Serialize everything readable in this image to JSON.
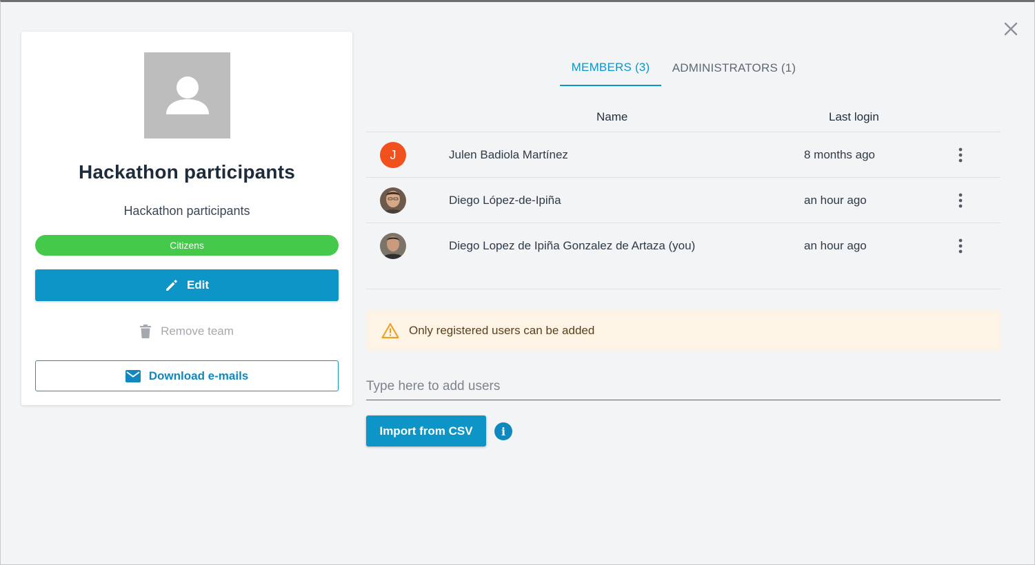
{
  "dialog": {
    "close_icon": "close-icon"
  },
  "team": {
    "avatar_icon": "person-icon",
    "title": "Hackathon participants",
    "description": "Hackathon participants",
    "badge": "Citizens",
    "badge_color": "#44c94a",
    "edit_label": "Edit",
    "remove_label": "Remove team",
    "download_label": "Download e-mails"
  },
  "tabs": [
    {
      "label": "MEMBERS (3)",
      "active": true
    },
    {
      "label": "ADMINISTRATORS (1)",
      "active": false
    }
  ],
  "table": {
    "columns": {
      "name": "Name",
      "last_login": "Last login"
    },
    "rows": [
      {
        "avatar_letter": "J",
        "avatar_type": "letter",
        "name": "Julen Badiola Martínez",
        "last_login": "8 months ago"
      },
      {
        "avatar_type": "photo",
        "name": "Diego López-de-Ipiña",
        "last_login": "an hour ago"
      },
      {
        "avatar_type": "photo",
        "name": "Diego Lopez de Ipiña Gonzalez de Artaza (you)",
        "last_login": "an hour ago"
      }
    ]
  },
  "warning": {
    "icon": "warning-icon",
    "text": "Only registered users can be added"
  },
  "add_users": {
    "placeholder": "Type here to add users",
    "value": ""
  },
  "import": {
    "label": "Import from CSV",
    "info_label": "i"
  },
  "colors": {
    "accent": "#0e95c8",
    "warning_bg": "#fdf4e6",
    "letter_avatar": "#f2501d"
  }
}
